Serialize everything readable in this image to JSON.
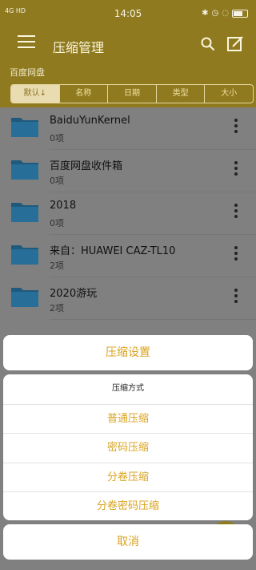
{
  "status_bar": {
    "network": "4G",
    "signal_label": "HD",
    "time": "14:05",
    "battery": "80"
  },
  "app_bar": {
    "title": "压缩管理",
    "menu_icon": "menu-icon",
    "search_icon": "search-icon",
    "edit_icon": "edit-icon"
  },
  "path": "百度网盘",
  "sort_tabs": [
    "默认↓",
    "名称",
    "日期",
    "类型",
    "大小"
  ],
  "files": [
    {
      "name": "BaiduYunKernel",
      "count": "0项"
    },
    {
      "name": "百度网盘收件箱",
      "count": "0项"
    },
    {
      "name": "2018",
      "count": "0项"
    },
    {
      "name": "来自：HUAWEI CAZ-TL10",
      "count": "2项"
    },
    {
      "name": "2020游玩",
      "count": "2项"
    }
  ],
  "sheet": {
    "title": "压缩设置",
    "section_header": "压缩方式",
    "options": [
      "普通压缩",
      "密码压缩",
      "分卷压缩",
      "分卷密码压缩"
    ],
    "cancel": "取消"
  },
  "colors": {
    "accent": "#d9a320",
    "brand_yellow": "#f0c93c",
    "folder_blue": "#2f8fc6"
  }
}
